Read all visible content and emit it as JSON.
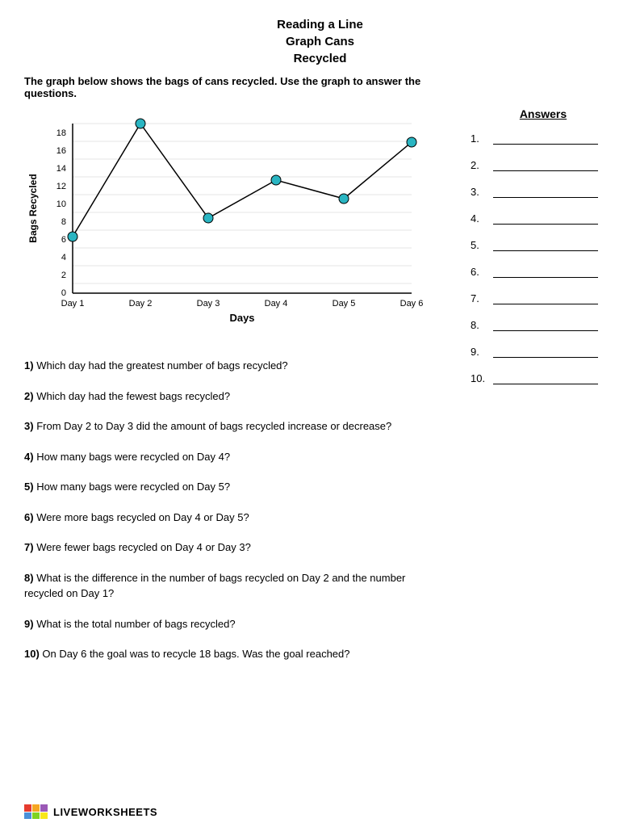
{
  "title": {
    "line1": "Reading a Line",
    "line2": "Graph Cans",
    "line3": "Recycled"
  },
  "intro": "The graph below shows the bags of cans recycled. Use the graph to answer the questions.",
  "answers": {
    "label": "Answers",
    "items": [
      {
        "num": "1."
      },
      {
        "num": "2."
      },
      {
        "num": "3."
      },
      {
        "num": "4."
      },
      {
        "num": "5."
      },
      {
        "num": "6."
      },
      {
        "num": "7."
      },
      {
        "num": "8."
      },
      {
        "num": "9."
      },
      {
        "num": "10."
      }
    ]
  },
  "chart": {
    "x_label": "Days",
    "y_label": "Bags Recycled",
    "x_axis": [
      "Day 1",
      "Day 2",
      "Day 3",
      "Day 4",
      "Day 5",
      "Day 6"
    ],
    "y_axis": [
      0,
      2,
      4,
      6,
      8,
      10,
      12,
      14,
      16,
      18
    ],
    "data_points": [
      {
        "day": "Day 1",
        "value": 6
      },
      {
        "day": "Day 2",
        "value": 18
      },
      {
        "day": "Day 3",
        "value": 8
      },
      {
        "day": "Day 4",
        "value": 12
      },
      {
        "day": "Day 5",
        "value": 10
      },
      {
        "day": "Day 6",
        "value": 16
      }
    ]
  },
  "questions": [
    {
      "num": "1)",
      "text": "Which day had the greatest number of bags recycled?"
    },
    {
      "num": "2)",
      "text": "Which day had the fewest bags recycled?"
    },
    {
      "num": "3)",
      "text": "From Day 2 to Day 3 did the amount of bags recycled increase or decrease?"
    },
    {
      "num": "4)",
      "text": "How many bags were recycled on Day 4?"
    },
    {
      "num": "5)",
      "text": "How many bags were recycled on Day 5?"
    },
    {
      "num": "6)",
      "text": "Were more bags recycled on Day 4 or Day 5?"
    },
    {
      "num": "7)",
      "text": "Were fewer bags recycled on Day 4 or Day 3?"
    },
    {
      "num": "8)",
      "text": "What is the difference in the number of bags recycled on Day 2 and the number recycled on Day 1?"
    },
    {
      "num": "9)",
      "text": "What is the total number of bags recycled?"
    },
    {
      "num": "10)",
      "text": "On Day 6 the goal was to recycle 18 bags. Was the goal reached?"
    }
  ],
  "footer": {
    "text": "LIVEWORKSHEETS",
    "logo_colors": [
      "#e63b2e",
      "#f5a623",
      "#f8e71c",
      "#7ed321",
      "#4a90d9",
      "#7b68ee",
      "#e63b2e",
      "#f5a623"
    ]
  }
}
